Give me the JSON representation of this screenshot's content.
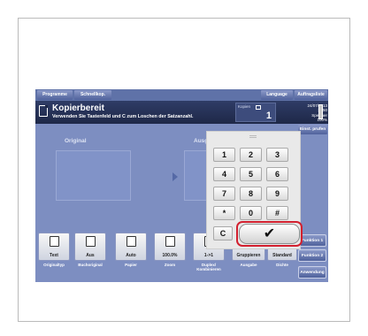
{
  "topbar": {
    "programme": "Programme",
    "schnellkop": "Schnellkop.",
    "language": "Language",
    "auftragsliste": "Auftragsliste"
  },
  "header": {
    "title": "Kopierbereit",
    "subtitle": "Verwenden Sie Tastenfeld und C zum Loschen der Satzanzahl.",
    "copies_label": "Kopien",
    "copies_value": "1",
    "date": "24/07/2013",
    "time": "11:50",
    "memory_label": "Speicher",
    "memory_value": "100%"
  },
  "einst_pruefen": "Einst. prufen",
  "panels": {
    "original": "Original",
    "ausgabe": "Ausg"
  },
  "tiles": [
    {
      "value": "Text",
      "label": "Originaltyp",
      "icon": "document-icon"
    },
    {
      "value": "Aus",
      "label": "Buchoriginal",
      "icon": "book-icon"
    },
    {
      "value": "Auto",
      "label": "Papier",
      "icon": "paper-icon"
    },
    {
      "value": "100.0%",
      "label": "Zoom",
      "icon": "zoom-icon"
    },
    {
      "value": "1->1",
      "label": "Duplex/ Kombinieren",
      "icon": "duplex-icon"
    },
    {
      "value": "Gruppieren",
      "label": "Ausgabe",
      "icon": "group-icon"
    },
    {
      "value": "Standard",
      "label": "Dichte",
      "icon": "density-icon"
    }
  ],
  "functions": {
    "f1": "Funktion 1",
    "f2": "Funktion 2",
    "anwendung": "Anwendung"
  },
  "keypad": {
    "keys": [
      "1",
      "2",
      "3",
      "4",
      "5",
      "6",
      "7",
      "8",
      "9",
      "*",
      "0",
      "#"
    ],
    "clear": "C",
    "ok": "✔"
  }
}
